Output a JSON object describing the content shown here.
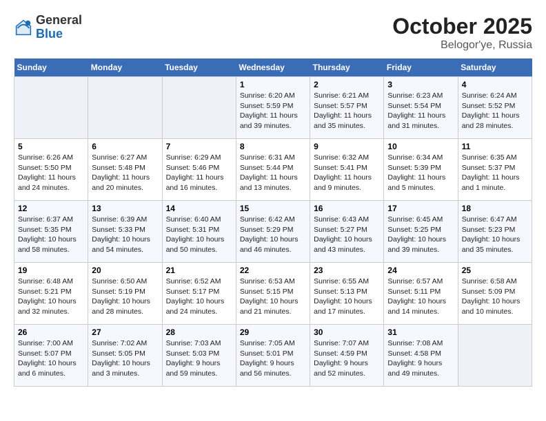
{
  "header": {
    "logo_line1": "General",
    "logo_line2": "Blue",
    "title": "October 2025",
    "subtitle": "Belogor'ye, Russia"
  },
  "weekdays": [
    "Sunday",
    "Monday",
    "Tuesday",
    "Wednesday",
    "Thursday",
    "Friday",
    "Saturday"
  ],
  "weeks": [
    [
      {
        "day": "",
        "info": ""
      },
      {
        "day": "",
        "info": ""
      },
      {
        "day": "",
        "info": ""
      },
      {
        "day": "1",
        "info": "Sunrise: 6:20 AM\nSunset: 5:59 PM\nDaylight: 11 hours\nand 39 minutes."
      },
      {
        "day": "2",
        "info": "Sunrise: 6:21 AM\nSunset: 5:57 PM\nDaylight: 11 hours\nand 35 minutes."
      },
      {
        "day": "3",
        "info": "Sunrise: 6:23 AM\nSunset: 5:54 PM\nDaylight: 11 hours\nand 31 minutes."
      },
      {
        "day": "4",
        "info": "Sunrise: 6:24 AM\nSunset: 5:52 PM\nDaylight: 11 hours\nand 28 minutes."
      }
    ],
    [
      {
        "day": "5",
        "info": "Sunrise: 6:26 AM\nSunset: 5:50 PM\nDaylight: 11 hours\nand 24 minutes."
      },
      {
        "day": "6",
        "info": "Sunrise: 6:27 AM\nSunset: 5:48 PM\nDaylight: 11 hours\nand 20 minutes."
      },
      {
        "day": "7",
        "info": "Sunrise: 6:29 AM\nSunset: 5:46 PM\nDaylight: 11 hours\nand 16 minutes."
      },
      {
        "day": "8",
        "info": "Sunrise: 6:31 AM\nSunset: 5:44 PM\nDaylight: 11 hours\nand 13 minutes."
      },
      {
        "day": "9",
        "info": "Sunrise: 6:32 AM\nSunset: 5:41 PM\nDaylight: 11 hours\nand 9 minutes."
      },
      {
        "day": "10",
        "info": "Sunrise: 6:34 AM\nSunset: 5:39 PM\nDaylight: 11 hours\nand 5 minutes."
      },
      {
        "day": "11",
        "info": "Sunrise: 6:35 AM\nSunset: 5:37 PM\nDaylight: 11 hours\nand 1 minute."
      }
    ],
    [
      {
        "day": "12",
        "info": "Sunrise: 6:37 AM\nSunset: 5:35 PM\nDaylight: 10 hours\nand 58 minutes."
      },
      {
        "day": "13",
        "info": "Sunrise: 6:39 AM\nSunset: 5:33 PM\nDaylight: 10 hours\nand 54 minutes."
      },
      {
        "day": "14",
        "info": "Sunrise: 6:40 AM\nSunset: 5:31 PM\nDaylight: 10 hours\nand 50 minutes."
      },
      {
        "day": "15",
        "info": "Sunrise: 6:42 AM\nSunset: 5:29 PM\nDaylight: 10 hours\nand 46 minutes."
      },
      {
        "day": "16",
        "info": "Sunrise: 6:43 AM\nSunset: 5:27 PM\nDaylight: 10 hours\nand 43 minutes."
      },
      {
        "day": "17",
        "info": "Sunrise: 6:45 AM\nSunset: 5:25 PM\nDaylight: 10 hours\nand 39 minutes."
      },
      {
        "day": "18",
        "info": "Sunrise: 6:47 AM\nSunset: 5:23 PM\nDaylight: 10 hours\nand 35 minutes."
      }
    ],
    [
      {
        "day": "19",
        "info": "Sunrise: 6:48 AM\nSunset: 5:21 PM\nDaylight: 10 hours\nand 32 minutes."
      },
      {
        "day": "20",
        "info": "Sunrise: 6:50 AM\nSunset: 5:19 PM\nDaylight: 10 hours\nand 28 minutes."
      },
      {
        "day": "21",
        "info": "Sunrise: 6:52 AM\nSunset: 5:17 PM\nDaylight: 10 hours\nand 24 minutes."
      },
      {
        "day": "22",
        "info": "Sunrise: 6:53 AM\nSunset: 5:15 PM\nDaylight: 10 hours\nand 21 minutes."
      },
      {
        "day": "23",
        "info": "Sunrise: 6:55 AM\nSunset: 5:13 PM\nDaylight: 10 hours\nand 17 minutes."
      },
      {
        "day": "24",
        "info": "Sunrise: 6:57 AM\nSunset: 5:11 PM\nDaylight: 10 hours\nand 14 minutes."
      },
      {
        "day": "25",
        "info": "Sunrise: 6:58 AM\nSunset: 5:09 PM\nDaylight: 10 hours\nand 10 minutes."
      }
    ],
    [
      {
        "day": "26",
        "info": "Sunrise: 7:00 AM\nSunset: 5:07 PM\nDaylight: 10 hours\nand 6 minutes."
      },
      {
        "day": "27",
        "info": "Sunrise: 7:02 AM\nSunset: 5:05 PM\nDaylight: 10 hours\nand 3 minutes."
      },
      {
        "day": "28",
        "info": "Sunrise: 7:03 AM\nSunset: 5:03 PM\nDaylight: 9 hours\nand 59 minutes."
      },
      {
        "day": "29",
        "info": "Sunrise: 7:05 AM\nSunset: 5:01 PM\nDaylight: 9 hours\nand 56 minutes."
      },
      {
        "day": "30",
        "info": "Sunrise: 7:07 AM\nSunset: 4:59 PM\nDaylight: 9 hours\nand 52 minutes."
      },
      {
        "day": "31",
        "info": "Sunrise: 7:08 AM\nSunset: 4:58 PM\nDaylight: 9 hours\nand 49 minutes."
      },
      {
        "day": "",
        "info": ""
      }
    ]
  ]
}
